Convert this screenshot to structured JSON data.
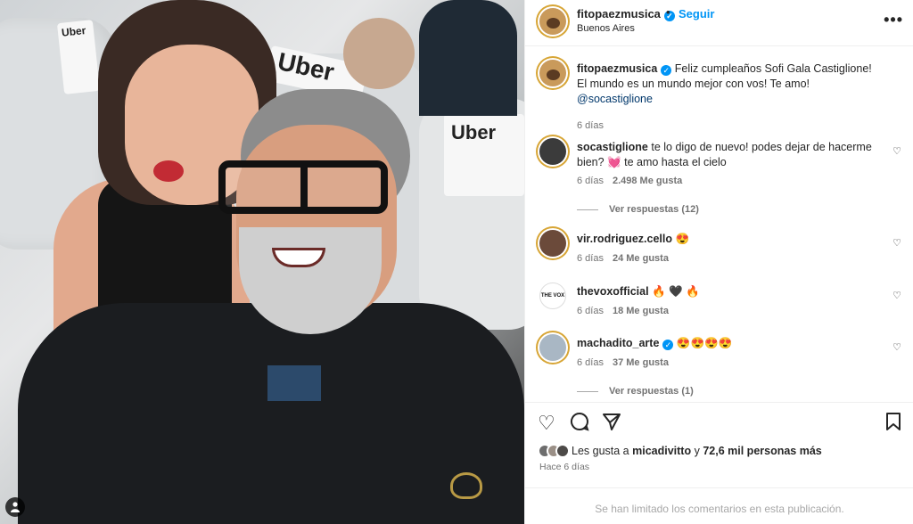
{
  "post": {
    "photo_brand_text": "Uber",
    "photo_user_tag_icon": "person-icon"
  },
  "header": {
    "username": "fitopaezmusica",
    "follow_label": "Seguir",
    "separator": "•",
    "location": "Buenos Aires",
    "more_icon": "•••"
  },
  "caption": {
    "username": "fitopaezmusica",
    "text": "Feliz cumpleaños Sofi Gala Castiglione! El mundo es un mundo mejor con vos! Te amo!",
    "mention": "@socastiglione",
    "time": "6 días"
  },
  "comments": [
    {
      "username": "socastiglione",
      "text": "te lo digo de nuevo! podes dejar de hacerme bien? 💓 te amo hasta el cielo",
      "time": "6 días",
      "likes": "2.498 Me gusta",
      "replies": "Ver respuestas (12)"
    },
    {
      "username": "vir.rodriguez.cello",
      "text": "😍",
      "time": "6 días",
      "likes": "24 Me gusta"
    },
    {
      "username": "thevoxofficial",
      "text": "🔥 🖤 🔥",
      "time": "6 días",
      "likes": "18 Me gusta",
      "avatar_text": "THE VOX"
    },
    {
      "username": "machadito_arte",
      "text": "😍😍😍😍",
      "time": "6 días",
      "likes": "37 Me gusta",
      "replies": "Ver respuestas (1)"
    }
  ],
  "actions": {
    "like_icon": "♡",
    "comment_icon": "◯",
    "share_icon": "➢",
    "save_icon": "🔖"
  },
  "likes": {
    "prefix": "Les gusta a",
    "user": "micadivitto",
    "conj": "y",
    "count": "72,6 mil personas más"
  },
  "post_time": "Hace 6 días",
  "footer": {
    "message": "Se han limitado los comentarios en esta publicación."
  },
  "colors": {
    "accent": "#0095f6",
    "story_ring": "#d7a535",
    "muted": "#737373"
  }
}
